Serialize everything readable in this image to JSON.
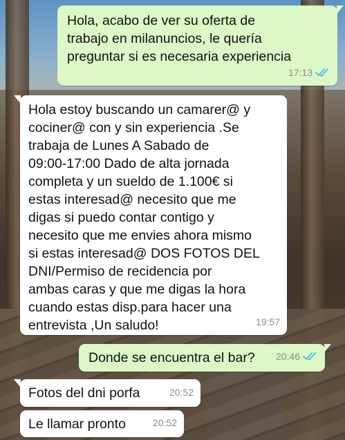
{
  "chat": {
    "messages": [
      {
        "direction": "outgoing",
        "text": "Hola, acabo de ver su oferta de\ntrabajo en milanuncios, le quería\npreguntar si es necesaria experiencia",
        "time": "17:13",
        "status": "read"
      },
      {
        "direction": "incoming",
        "text": "Hola estoy buscando un camarer@ y\ncociner@ con y sin experiencia .Se\ntrabaja de Lunes A Sabado de\n09:00-17:00 Dado de alta jornada\ncompleta y un sueldo de  1.100€ si\nestas interesad@ necesito que me\ndigas si puedo contar contigo y\nnecesito que me envies ahora mismo\nsi estas interesad@ DOS FOTOS DEL\nDNI/Permiso de recidencia por\nambas caras y que me digas la hora\ncuando estas disp.para hacer una\nentrevista ,Un saludo!",
        "time": "19:57"
      },
      {
        "direction": "outgoing",
        "text": "Donde se encuentra el bar?",
        "time": "20:46",
        "status": "read"
      },
      {
        "direction": "incoming",
        "text": "Fotos del dni porfa",
        "time": "20:52"
      },
      {
        "direction": "incoming",
        "text": "Le llamar pronto",
        "time": "20:52"
      }
    ]
  },
  "colors": {
    "outgoing_bubble": "#dcf8c6",
    "incoming_bubble": "#ffffff",
    "read_ticks": "#4fb6ec",
    "timestamp": "#8a8a8a"
  },
  "icons": {
    "read_receipt": "double-check-icon"
  }
}
